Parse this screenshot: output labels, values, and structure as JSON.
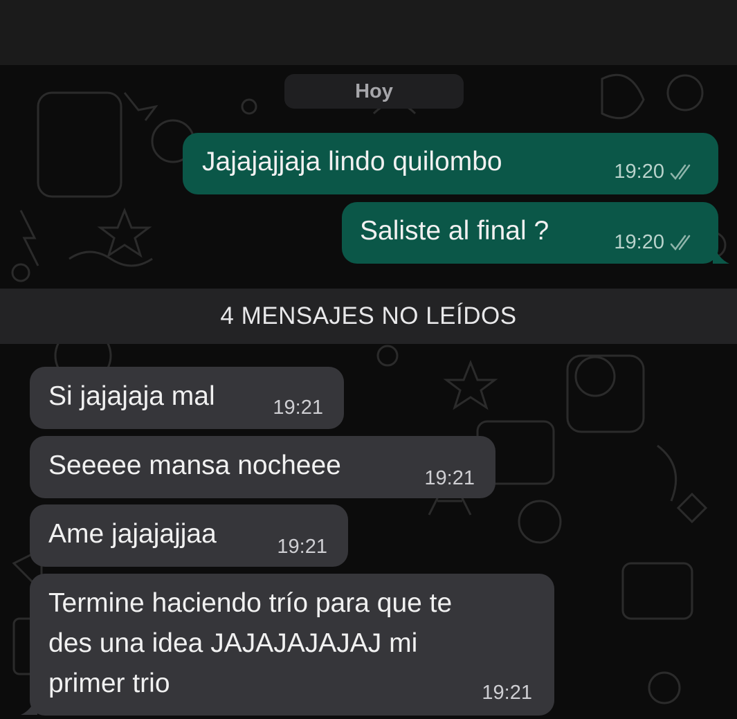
{
  "header": {},
  "date_chip": {
    "label": "Hoy"
  },
  "messages_out": [
    {
      "text": "Jajajajjaja lindo quilombo",
      "time": "19:20",
      "status_icon": "double-check-icon"
    },
    {
      "text": "Saliste al final ?",
      "time": "19:20",
      "status_icon": "double-check-icon"
    }
  ],
  "unread_divider": {
    "label": "4 MENSAJES NO LEÍDOS"
  },
  "messages_in": [
    {
      "text": "Si jajajaja mal",
      "time": "19:21"
    },
    {
      "text": "Seeeee mansa nocheee",
      "time": "19:21"
    },
    {
      "text": "Ame jajajajjaa",
      "time": "19:21"
    },
    {
      "lines": [
        "Termine haciendo trío para que te",
        "des una idea JAJAJAJAJAJ mi",
        "primer trio"
      ],
      "time": "19:21"
    }
  ],
  "colors": {
    "outgoing_bubble": "#0b5748",
    "incoming_bubble": "#36363a",
    "chat_background": "#0c0c0c",
    "top_bar": "#1b1b1b",
    "unread_bar": "#232325"
  }
}
